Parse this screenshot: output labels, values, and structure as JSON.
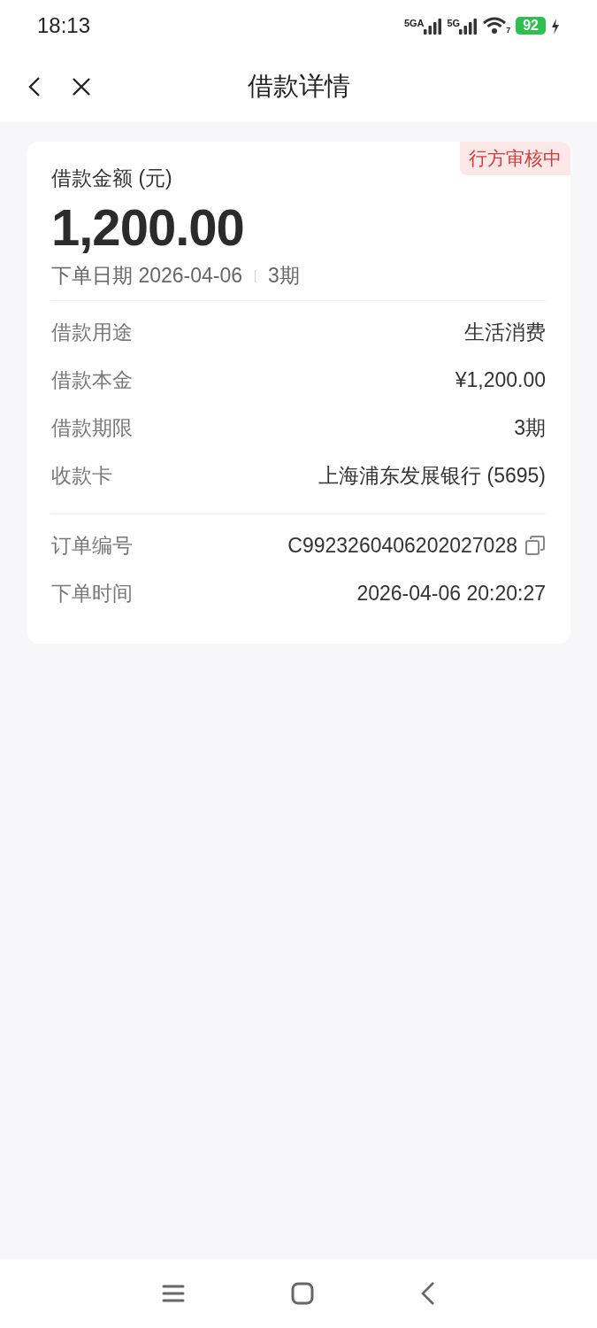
{
  "status_bar": {
    "time": "18:13",
    "signals": [
      "5GA",
      "5G"
    ],
    "wifi_badge": "7",
    "battery": "92",
    "charging": true
  },
  "header": {
    "title": "借款详情"
  },
  "loan": {
    "badge": "行方审核中",
    "amount_label": "借款金额 (元)",
    "amount": "1,200.00",
    "date_label": "下单日期 2026-04-06",
    "term": "3期"
  },
  "sections": [
    {
      "rows": [
        {
          "kind": "plain",
          "label": "借款用途",
          "value": "生活消费"
        },
        {
          "kind": "plain",
          "label": "借款本金",
          "value": "¥1,200.00"
        },
        {
          "kind": "plain",
          "label": "借款期限",
          "value": "3期"
        },
        {
          "kind": "plain",
          "label": "收款卡",
          "value": "上海浦东发展银行 (5695)"
        }
      ]
    },
    {
      "rows": [
        {
          "kind": "copy",
          "label": "订单编号",
          "value": "C9923260406202027028"
        },
        {
          "kind": "plain",
          "label": "下单时间",
          "value": "2026-04-06 20:20:27"
        }
      ]
    }
  ]
}
